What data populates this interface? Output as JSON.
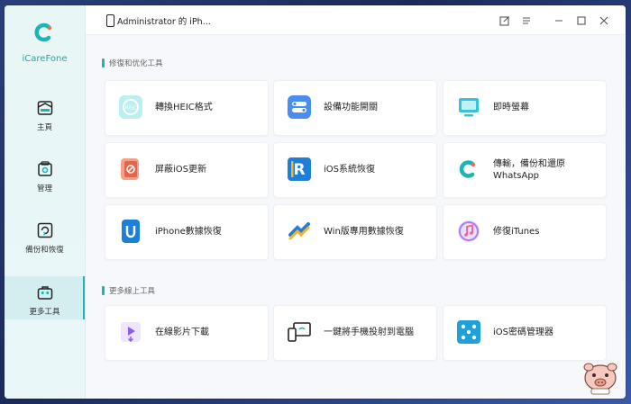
{
  "app": {
    "name": "iCareFone"
  },
  "device": {
    "name": "Administrator 的 iPh..."
  },
  "sidebar": {
    "items": [
      {
        "label": "主頁",
        "icon": "home-icon"
      },
      {
        "label": "管理",
        "icon": "manage-icon"
      },
      {
        "label": "備份和恢復",
        "icon": "backup-restore-icon"
      },
      {
        "label": "更多工具",
        "icon": "toolbox-icon",
        "active": true
      }
    ]
  },
  "sections": {
    "repair": {
      "title": "修復和优化工具",
      "tools": [
        {
          "label": "轉換HEIC格式",
          "icon": "heic-convert-icon"
        },
        {
          "label": "設備功能開關",
          "icon": "device-toggle-icon"
        },
        {
          "label": "即時螢幕",
          "icon": "screen-mirror-icon"
        },
        {
          "label": "屏蔽iOS更新",
          "icon": "block-ios-update-icon"
        },
        {
          "label": "iOS系統恢復",
          "icon": "ios-system-recovery-icon"
        },
        {
          "label": "傳輸，備份和還原",
          "label2": "WhatsApp",
          "icon": "whatsapp-transfer-icon"
        },
        {
          "label": "iPhone數據恢復",
          "icon": "iphone-data-recovery-icon"
        },
        {
          "label": "Win版專用數據恢復",
          "icon": "win-data-recovery-icon"
        },
        {
          "label": "修復iTunes",
          "icon": "repair-itunes-icon"
        }
      ]
    },
    "online": {
      "title": "更多線上工具",
      "tools": [
        {
          "label": "在線影片下載",
          "icon": "video-download-icon"
        },
        {
          "label": "一鍵將手機投射到電腦",
          "icon": "phone-to-pc-icon"
        },
        {
          "label": "iOS密碼管理器",
          "icon": "password-manager-icon"
        }
      ]
    }
  },
  "colors": {
    "accent": "#1cb5b5",
    "background": "#f6f8fb"
  }
}
